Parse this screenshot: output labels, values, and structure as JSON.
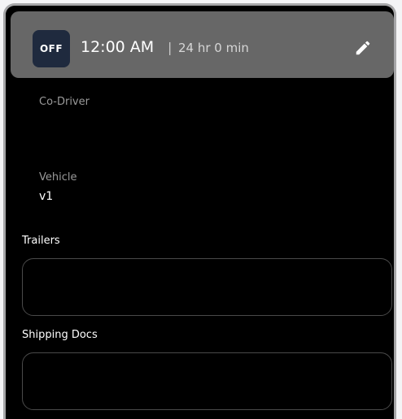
{
  "status": {
    "code": "OFF",
    "time": "12:00 AM",
    "separator": "|",
    "duration": "24 hr 0 min"
  },
  "co_driver": {
    "label": "Co-Driver",
    "value": ""
  },
  "vehicle": {
    "label": "Vehicle",
    "value": "v1"
  },
  "trailers": {
    "label": "Trailers",
    "value": ""
  },
  "shipping_docs": {
    "label": "Shipping Docs",
    "value": ""
  },
  "icons": {
    "edit": "pencil-icon"
  },
  "colors": {
    "card_background": "#000000",
    "header_background": "#676767",
    "badge_background": "#1f2a3e",
    "border": "#a6a6a8"
  }
}
